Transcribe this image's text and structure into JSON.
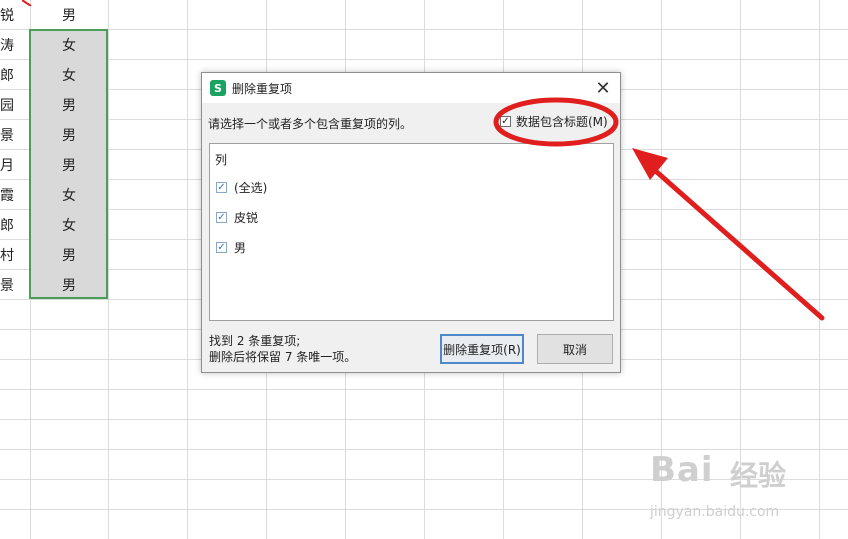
{
  "spreadsheet": {
    "header_row": {
      "col_a": "锐",
      "col_b": "男"
    },
    "rows": [
      {
        "col_a": "涛",
        "col_b": "女"
      },
      {
        "col_a": "郎",
        "col_b": "女"
      },
      {
        "col_a": "园",
        "col_b": "男"
      },
      {
        "col_a": "景",
        "col_b": "男"
      },
      {
        "col_a": "月",
        "col_b": "男"
      },
      {
        "col_a": "霞",
        "col_b": "女"
      },
      {
        "col_a": "郎",
        "col_b": "女"
      },
      {
        "col_a": "村",
        "col_b": "男"
      },
      {
        "col_a": "景",
        "col_b": "男"
      }
    ]
  },
  "dialog": {
    "app_icon_letter": "S",
    "title": "删除重复项",
    "close_glyph": "✕",
    "prompt": "请选择一个或者多个包含重复项的列。",
    "header_checkbox": {
      "label": "数据包含标题(M)",
      "checked_glyph": "✓"
    },
    "list": {
      "header": "列",
      "items": [
        {
          "label": "(全选)",
          "checked_glyph": "✓"
        },
        {
          "label": "皮锐",
          "checked_glyph": "✓"
        },
        {
          "label": "男",
          "checked_glyph": "✓"
        }
      ]
    },
    "status_line1": "找到 2 条重复项;",
    "status_line2": "删除后将保留 7 条唯一项。",
    "delete_button": "删除重复项(R)",
    "cancel_button": "取消"
  },
  "watermark": {
    "main": "Bai",
    "cn": "经验",
    "url": "jingyan.baidu.com"
  },
  "colors": {
    "annotation_red": "#e01e1e",
    "selection_green": "#4a9e5a",
    "accent": "#1aa260"
  }
}
